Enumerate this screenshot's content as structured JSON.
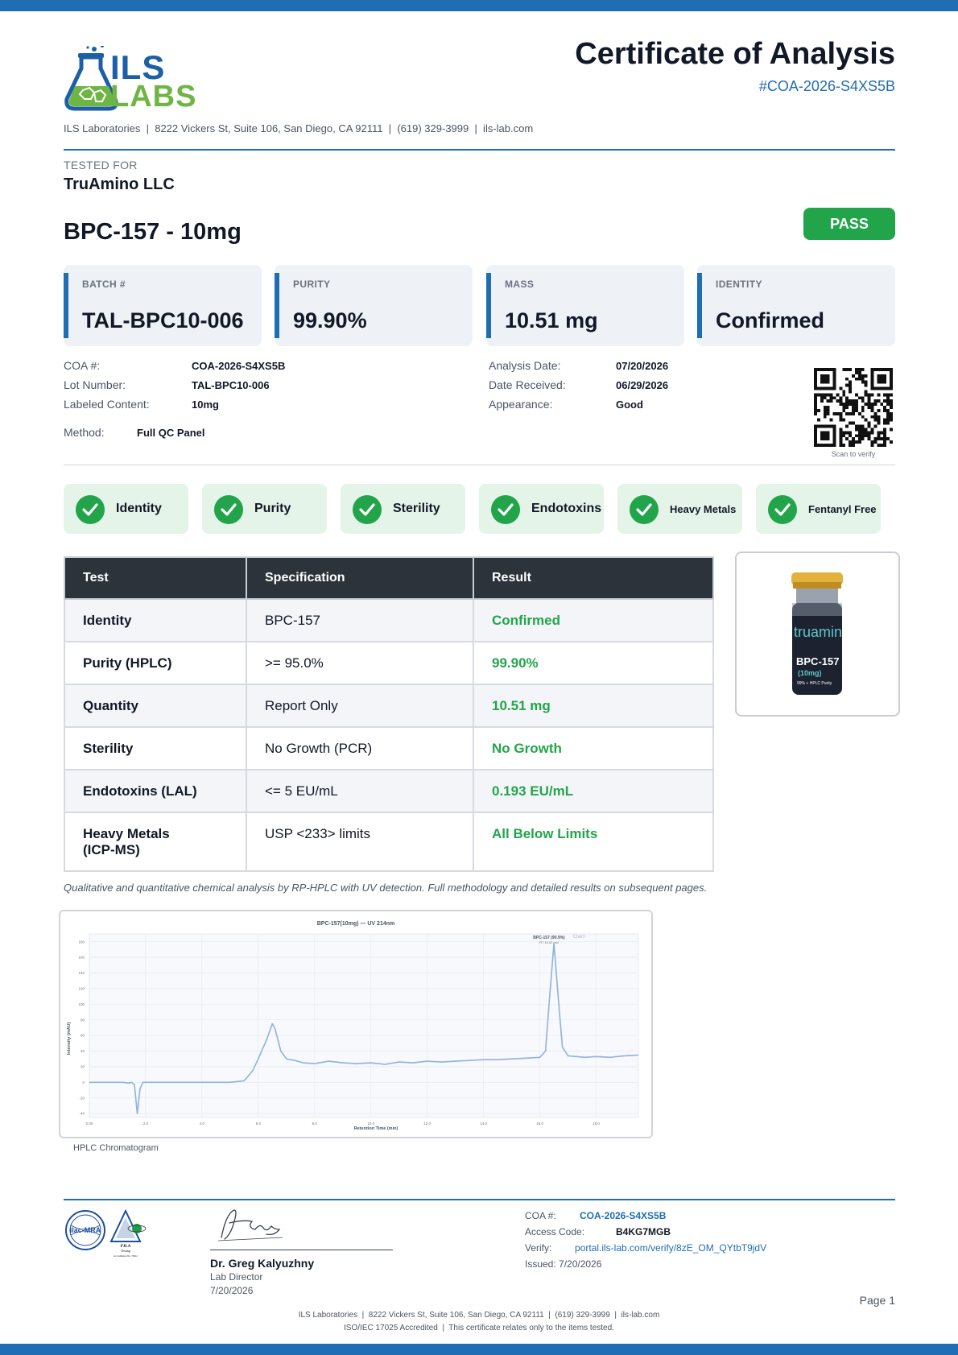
{
  "header": {
    "logo_line1": "ILS",
    "logo_line2": "LABS",
    "title": "Certificate of Analysis",
    "doc_number": "#COA-2026-S4XS5B",
    "lab_info": "ILS Laboratories  |  8222 Vickers St, Suite 106, San Diego, CA 92111  |  (619) 329-3999  |  ils-lab.com"
  },
  "client": {
    "label": "TESTED FOR",
    "name": "TruAmino LLC"
  },
  "product": {
    "name": "BPC-157 - 10mg",
    "status": "PASS"
  },
  "summary_cards": [
    {
      "label": "BATCH #",
      "value": "TAL-BPC10-006"
    },
    {
      "label": "PURITY",
      "value": "99.90%"
    },
    {
      "label": "MASS",
      "value": "10.51 mg"
    },
    {
      "label": "IDENTITY",
      "value": "Confirmed"
    }
  ],
  "details": {
    "coa_label": "COA #:",
    "coa_value": "COA-2026-S4XS5B",
    "lot_label": "Lot Number:",
    "lot_value": "TAL-BPC10-006",
    "labeled_label": "Labeled Content:",
    "labeled_value": "10mg",
    "method_label": "Method:",
    "method_value": "Full QC Panel",
    "analysis_label": "Analysis Date:",
    "analysis_value": "07/20/2026",
    "received_label": "Date Received:",
    "received_value": "06/29/2026",
    "appearance_label": "Appearance:",
    "appearance_value": "Good",
    "qr_caption": "Scan to verify"
  },
  "test_pills": [
    {
      "label": "Identity"
    },
    {
      "label": "Purity"
    },
    {
      "label": "Sterility"
    },
    {
      "label": "Endotoxins"
    },
    {
      "label": "Heavy Metals"
    },
    {
      "label": "Fentanyl Free"
    }
  ],
  "results_table": {
    "headers": [
      "Test",
      "Specification",
      "Result"
    ],
    "rows": [
      {
        "test": "Identity",
        "spec": "BPC-157",
        "result": "Confirmed"
      },
      {
        "test": "Purity (HPLC)",
        "spec": ">= 95.0%",
        "result": "99.90%"
      },
      {
        "test": "Quantity",
        "spec": "Report Only",
        "result": "10.51 mg"
      },
      {
        "test": "Sterility",
        "spec": "No Growth (PCR)",
        "result": "No Growth"
      },
      {
        "test": "Endotoxins (LAL)",
        "spec": "<= 5 EU/mL",
        "result": "0.193 EU/mL"
      },
      {
        "test": "Heavy Metals (ICP-MS)",
        "spec": "USP <233> limits",
        "result": "All Below Limits"
      }
    ]
  },
  "vial": {
    "brand": "truamin",
    "product": "BPC-157",
    "dose": "(10mg)",
    "note": "99% + HPLC Purity"
  },
  "method_note": "Qualitative and quantitative chemical analysis by RP-HPLC with UV detection. Full methodology and detailed results on subsequent pages.",
  "chromatogram": {
    "title": "BPC-157(10mg) — UV 214nm",
    "peak_label": "BPC-157 (99.9%)",
    "peak_sublabel": "RT 16.52 min",
    "legend": "Claim",
    "xlabel": "Retention Time (min)",
    "ylabel": "Intensity (mAU)",
    "caption": "HPLC Chromatogram"
  },
  "chart_data": {
    "type": "line",
    "title": "BPC-157(10mg) — UV 214nm",
    "xlabel": "Retention Time (min)",
    "ylabel": "Intensity (mAU)",
    "xlim": [
      0,
      19.5
    ],
    "ylim": [
      -45,
      190
    ],
    "xticks": [
      "0.00",
      "2.0",
      "4.0",
      "6.0",
      "8.0",
      "10.0",
      "12.0",
      "14.0",
      "16.0",
      "18.0"
    ],
    "yticks": [
      "180",
      "160",
      "140",
      "120",
      "100",
      "80",
      "60",
      "40",
      "20",
      "0",
      "-20",
      "-40"
    ],
    "series": [
      {
        "x": [
          0,
          1.2,
          1.4,
          1.5,
          1.6,
          1.7,
          1.8,
          1.9,
          2.0,
          2.2,
          5.0,
          5.5,
          5.8,
          6.0,
          6.3,
          6.5,
          6.6,
          6.8,
          7.0,
          7.3,
          7.6,
          8.0,
          8.5,
          9.0,
          9.5,
          10.0,
          10.5,
          11.0,
          11.5,
          12.0,
          12.5,
          13.0,
          13.5,
          14.0,
          14.5,
          15.0,
          15.5,
          16.0,
          16.2,
          16.35,
          16.5,
          16.65,
          16.8,
          17.0,
          17.3,
          17.6,
          18.0,
          18.5,
          19.0,
          19.5
        ],
        "y": [
          0,
          0,
          -1,
          0,
          -3,
          -40,
          -8,
          0,
          0,
          0,
          0,
          2,
          15,
          30,
          55,
          75,
          68,
          40,
          30,
          28,
          25,
          24,
          27,
          25,
          24,
          25,
          23,
          26,
          25,
          27,
          26,
          27,
          28,
          29,
          29,
          30,
          31,
          32,
          40,
          110,
          178,
          110,
          45,
          34,
          33,
          32,
          33,
          32,
          34,
          35
        ]
      }
    ]
  },
  "footer": {
    "signer_name": "Dr. Greg Kalyuzhny",
    "signer_role": "Lab Director",
    "signer_date": "7/20/2026",
    "coa_label": "COA #:",
    "coa_value": "COA-2026-S4XS5B",
    "access_label": "Access Code:",
    "access_value": "B4KG7MGB",
    "verify_label": "Verify:",
    "verify_value": "portal.ils-lab.com/verify/8zE_OM_QYtbT9jdV",
    "issued": "Issued: 7/20/2026",
    "page": "Page 1",
    "line1": "ILS Laboratories  |  8222 Vickers St, Suite 106, San Diego, CA 92111  |  (619) 329-3999  |  ils-lab.com",
    "line2": "ISO/IEC 17025 Accredited  |  This certificate relates only to the items tested.",
    "ilac_text": "ilac-MRA",
    "pjla_text": "PJLA",
    "pjla_sub": "Testing",
    "pjla_accr": "Accreditation No. 79912"
  },
  "colors": {
    "brand_blue": "#1f6db5",
    "brand_green": "#6fb544",
    "pass_green": "#22a54a",
    "table_header": "#2d333b"
  }
}
